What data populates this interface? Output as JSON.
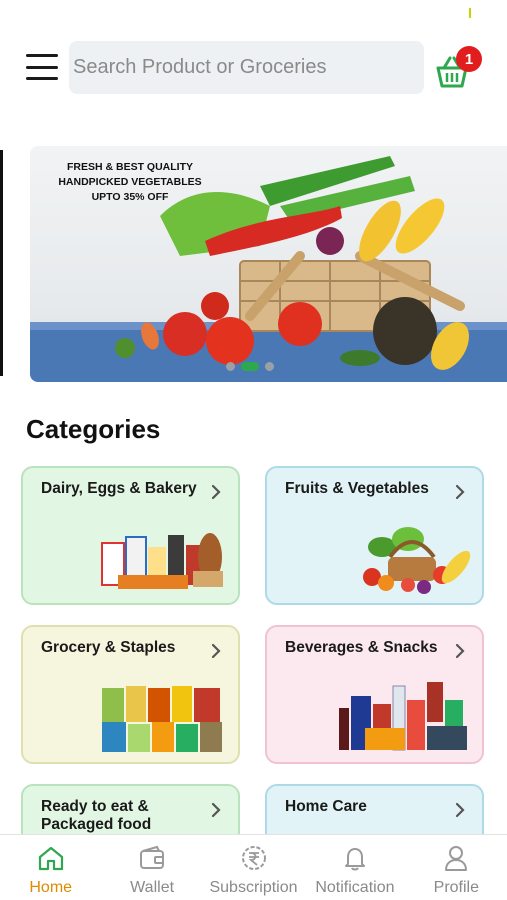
{
  "header": {
    "search_placeholder": "Search Product or Groceries",
    "cart_count": "1"
  },
  "banner": {
    "line1": "FRESH & BEST QUALITY",
    "line2": "HANDPICKED VEGETABLES",
    "line3": "UPTO 35% OFF",
    "slide_count": 3,
    "active_slide": 2
  },
  "categories": {
    "title": "Categories",
    "items": [
      {
        "label": "Dairy, Eggs & Bakery",
        "color": "#e2f6e4"
      },
      {
        "label": "Fruits & Vegetables",
        "color": "#e2f3f8"
      },
      {
        "label": "Grocery & Staples",
        "color": "#f6f6df"
      },
      {
        "label": "Beverages & Snacks",
        "color": "#fbe9ef"
      },
      {
        "label": "Ready to eat & Packaged food",
        "color": "#e2f6e4"
      },
      {
        "label": "Home Care",
        "color": "#e2f3f8"
      }
    ]
  },
  "bottom_nav": {
    "items": [
      {
        "label": "Home",
        "icon": "home-icon",
        "active": true
      },
      {
        "label": "Wallet",
        "icon": "wallet-icon"
      },
      {
        "label": "Subscription",
        "icon": "rupee-icon"
      },
      {
        "label": "Notification",
        "icon": "bell-icon"
      },
      {
        "label": "Profile",
        "icon": "user-icon"
      }
    ]
  },
  "colors": {
    "accent_green": "#2ea84f",
    "active_nav": "#e08a00",
    "badge": "#e11d1d"
  }
}
